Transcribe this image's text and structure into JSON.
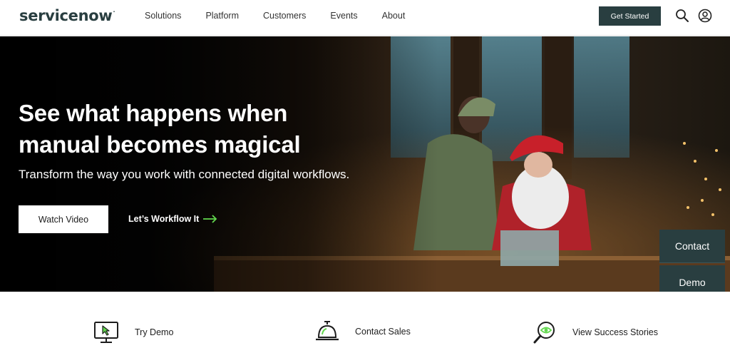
{
  "header": {
    "logo_text": "servicenow",
    "nav": [
      "Solutions",
      "Platform",
      "Customers",
      "Events",
      "About"
    ],
    "cta_label": "Get Started",
    "icons": [
      "search-icon",
      "user-icon"
    ]
  },
  "hero": {
    "title": "See what happens when manual becomes magical",
    "subtitle": "Transform the way you work with connected digital workflows.",
    "watch_label": "Watch Video",
    "workflow_label": "Let’s Workflow It"
  },
  "side": {
    "contact_label": "Contact",
    "demo_label": "Demo"
  },
  "actions": [
    {
      "label": "Try Demo",
      "icon": "monitor-cursor-icon"
    },
    {
      "label": "Contact Sales",
      "icon": "service-bell-icon"
    },
    {
      "label": "View Success Stories",
      "icon": "magnifier-icon"
    }
  ],
  "colors": {
    "brand_dark": "#293e40",
    "accent_green": "#62d84e"
  }
}
